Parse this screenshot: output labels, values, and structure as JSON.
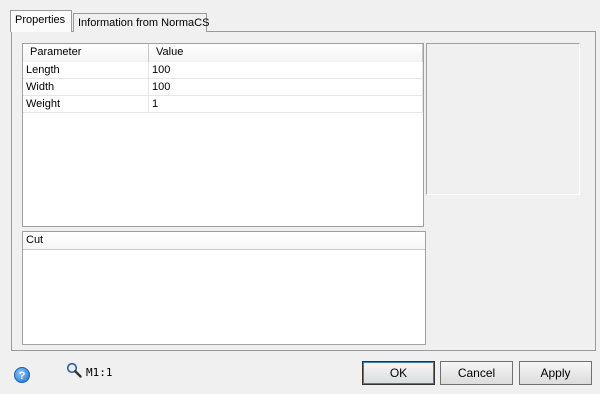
{
  "tabs": [
    {
      "label": "Properties",
      "active": true
    },
    {
      "label": "Information from NormaCS",
      "active": false
    }
  ],
  "grid": {
    "columns": [
      "Parameter",
      "Value"
    ],
    "rows": [
      {
        "parameter": "Length",
        "value": "100"
      },
      {
        "parameter": "Width",
        "value": "100"
      },
      {
        "parameter": "Weight",
        "value": "1"
      }
    ]
  },
  "cut": {
    "header": "Cut"
  },
  "statusbar": {
    "help_icon": "help-icon",
    "help_glyph": "?",
    "zoom_icon": "magnifier-icon",
    "zoom_label": "M1:1"
  },
  "buttons": {
    "ok": "OK",
    "cancel": "Cancel",
    "apply": "Apply"
  }
}
